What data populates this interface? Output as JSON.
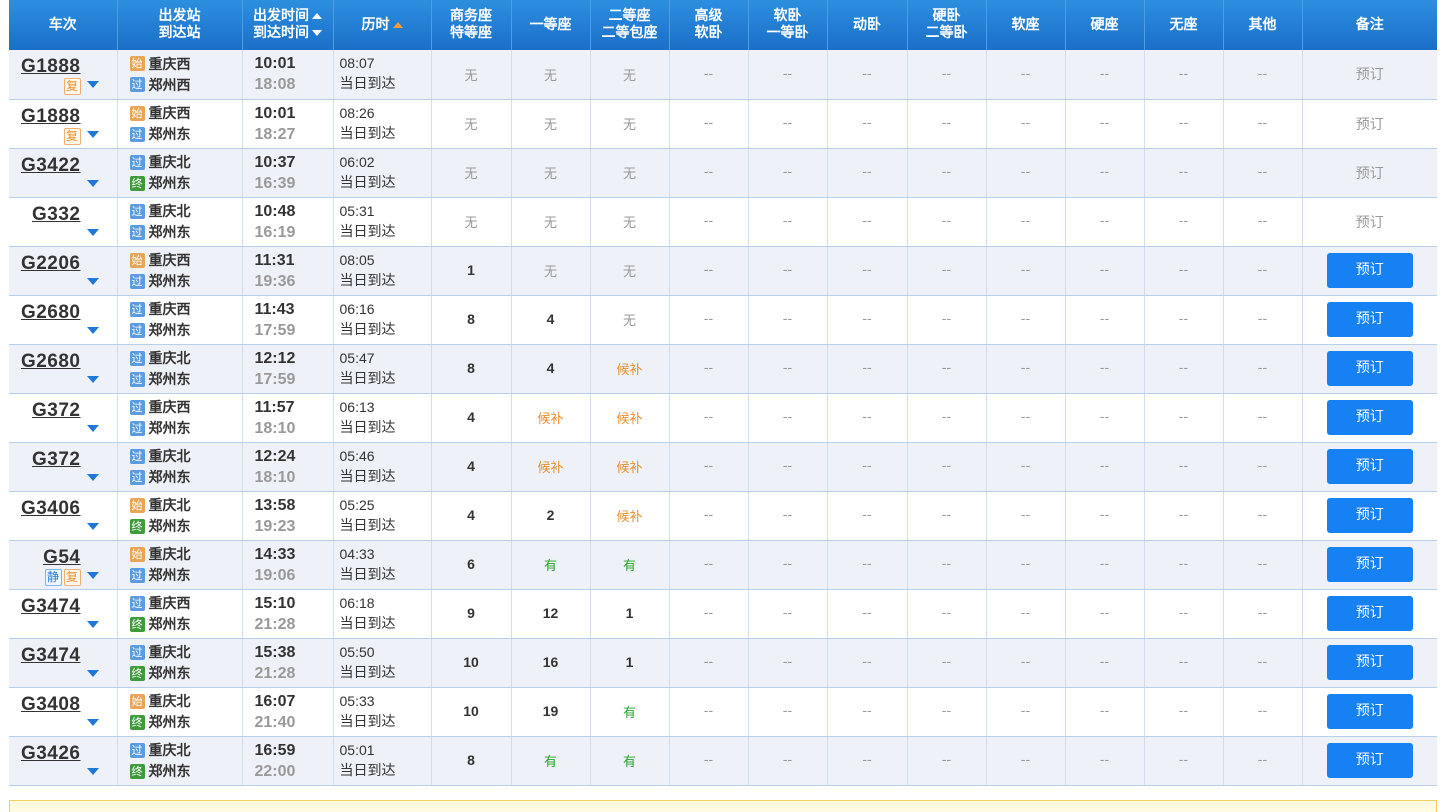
{
  "header": {
    "train": "车次",
    "station_line1": "出发站",
    "station_line2": "到达站",
    "time_line1": "出发时间",
    "time_line2": "到达时间",
    "duration": "历时",
    "business_line1": "商务座",
    "business_line2": "特等座",
    "first": "一等座",
    "second_line1": "二等座",
    "second_line2": "二等包座",
    "adv_sleeper_line1": "高级",
    "adv_sleeper_line2": "软卧",
    "soft_sleeper_line1": "软卧",
    "soft_sleeper_line2": "一等卧",
    "emu_sleeper": "动卧",
    "hard_sleeper_line1": "硬卧",
    "hard_sleeper_line2": "二等卧",
    "soft_seat": "软座",
    "hard_seat": "硬座",
    "no_seat": "无座",
    "other": "其他",
    "remark": "备注"
  },
  "rows": [
    {
      "train": "G1888",
      "badges": [
        "复"
      ],
      "from_type": "始",
      "from": "重庆西",
      "to_type": "过",
      "to": "郑州西",
      "dep": "10:01",
      "arr": "18:08",
      "dur": "08:07",
      "day": "当日到达",
      "business": "无",
      "first": "无",
      "second": "无",
      "book": "预订",
      "book_enabled": false
    },
    {
      "train": "G1888",
      "badges": [
        "复"
      ],
      "from_type": "始",
      "from": "重庆西",
      "to_type": "过",
      "to": "郑州东",
      "dep": "10:01",
      "arr": "18:27",
      "dur": "08:26",
      "day": "当日到达",
      "business": "无",
      "first": "无",
      "second": "无",
      "book": "预订",
      "book_enabled": false
    },
    {
      "train": "G3422",
      "badges": [],
      "from_type": "过",
      "from": "重庆北",
      "to_type": "终",
      "to": "郑州东",
      "dep": "10:37",
      "arr": "16:39",
      "dur": "06:02",
      "day": "当日到达",
      "business": "无",
      "first": "无",
      "second": "无",
      "book": "预订",
      "book_enabled": false
    },
    {
      "train": "G332",
      "badges": [],
      "from_type": "过",
      "from": "重庆北",
      "to_type": "过",
      "to": "郑州东",
      "dep": "10:48",
      "arr": "16:19",
      "dur": "05:31",
      "day": "当日到达",
      "business": "无",
      "first": "无",
      "second": "无",
      "book": "预订",
      "book_enabled": false
    },
    {
      "train": "G2206",
      "badges": [],
      "from_type": "始",
      "from": "重庆西",
      "to_type": "过",
      "to": "郑州东",
      "dep": "11:31",
      "arr": "19:36",
      "dur": "08:05",
      "day": "当日到达",
      "business": "1",
      "first": "无",
      "second": "无",
      "book": "预订",
      "book_enabled": true
    },
    {
      "train": "G2680",
      "badges": [],
      "from_type": "过",
      "from": "重庆西",
      "to_type": "过",
      "to": "郑州东",
      "dep": "11:43",
      "arr": "17:59",
      "dur": "06:16",
      "day": "当日到达",
      "business": "8",
      "first": "4",
      "second": "无",
      "book": "预订",
      "book_enabled": true
    },
    {
      "train": "G2680",
      "badges": [],
      "from_type": "过",
      "from": "重庆北",
      "to_type": "过",
      "to": "郑州东",
      "dep": "12:12",
      "arr": "17:59",
      "dur": "05:47",
      "day": "当日到达",
      "business": "8",
      "first": "4",
      "second": "候补",
      "book": "预订",
      "book_enabled": true
    },
    {
      "train": "G372",
      "badges": [],
      "from_type": "过",
      "from": "重庆西",
      "to_type": "过",
      "to": "郑州东",
      "dep": "11:57",
      "arr": "18:10",
      "dur": "06:13",
      "day": "当日到达",
      "business": "4",
      "first": "候补",
      "second": "候补",
      "book": "预订",
      "book_enabled": true
    },
    {
      "train": "G372",
      "badges": [],
      "from_type": "过",
      "from": "重庆北",
      "to_type": "过",
      "to": "郑州东",
      "dep": "12:24",
      "arr": "18:10",
      "dur": "05:46",
      "day": "当日到达",
      "business": "4",
      "first": "候补",
      "second": "候补",
      "book": "预订",
      "book_enabled": true
    },
    {
      "train": "G3406",
      "badges": [],
      "from_type": "始",
      "from": "重庆北",
      "to_type": "终",
      "to": "郑州东",
      "dep": "13:58",
      "arr": "19:23",
      "dur": "05:25",
      "day": "当日到达",
      "business": "4",
      "first": "2",
      "second": "候补",
      "book": "预订",
      "book_enabled": true
    },
    {
      "train": "G54",
      "badges": [
        "静",
        "复"
      ],
      "from_type": "始",
      "from": "重庆北",
      "to_type": "过",
      "to": "郑州东",
      "dep": "14:33",
      "arr": "19:06",
      "dur": "04:33",
      "day": "当日到达",
      "business": "6",
      "first": "有",
      "second": "有",
      "book": "预订",
      "book_enabled": true
    },
    {
      "train": "G3474",
      "badges": [],
      "from_type": "过",
      "from": "重庆西",
      "to_type": "终",
      "to": "郑州东",
      "dep": "15:10",
      "arr": "21:28",
      "dur": "06:18",
      "day": "当日到达",
      "business": "9",
      "first": "12",
      "second": "1",
      "book": "预订",
      "book_enabled": true
    },
    {
      "train": "G3474",
      "badges": [],
      "from_type": "过",
      "from": "重庆北",
      "to_type": "终",
      "to": "郑州东",
      "dep": "15:38",
      "arr": "21:28",
      "dur": "05:50",
      "day": "当日到达",
      "business": "10",
      "first": "16",
      "second": "1",
      "book": "预订",
      "book_enabled": true
    },
    {
      "train": "G3408",
      "badges": [],
      "from_type": "始",
      "from": "重庆北",
      "to_type": "终",
      "to": "郑州东",
      "dep": "16:07",
      "arr": "21:40",
      "dur": "05:33",
      "day": "当日到达",
      "business": "10",
      "first": "19",
      "second": "有",
      "book": "预订",
      "book_enabled": true
    },
    {
      "train": "G3426",
      "badges": [],
      "from_type": "过",
      "from": "重庆北",
      "to_type": "终",
      "to": "郑州东",
      "dep": "16:59",
      "arr": "22:00",
      "dur": "05:01",
      "day": "当日到达",
      "business": "8",
      "first": "有",
      "second": "有",
      "book": "预订",
      "book_enabled": true
    }
  ],
  "empty_seat": "--",
  "colors": {
    "header": "#1a6fc7",
    "book_button": "#1581f3",
    "wait": "#e88f2e",
    "have": "#26a626"
  }
}
